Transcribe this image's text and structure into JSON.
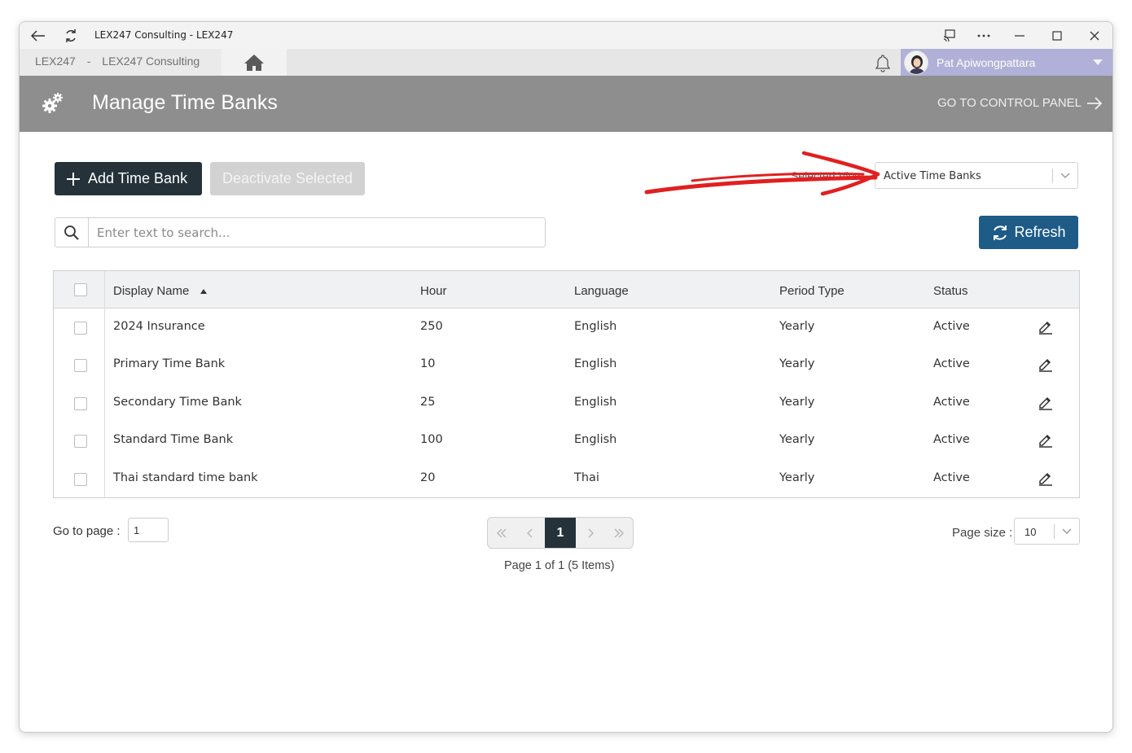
{
  "window": {
    "title": "LEX247 Consulting - LEX247"
  },
  "appbar": {
    "crumb_org": "LEX247",
    "crumb_sep": "-",
    "crumb_company": "LEX247 Consulting",
    "user_name": "Pat Apiwongpattara",
    "user_color": "#b0b0d8"
  },
  "header": {
    "title": "Manage Time Banks",
    "go_to": "GO TO CONTROL PANEL",
    "bg_color": "#8e8e8e"
  },
  "toolbar": {
    "add_label": "Add Time Bank",
    "deactivate_label": "Deactivate Selected",
    "selected_view_label": "Selected View",
    "selected_view_value": "Active Time Banks",
    "refresh_label": "Refresh"
  },
  "search": {
    "placeholder": "Enter text to search..."
  },
  "grid": {
    "columns": [
      "Display Name",
      "Hour",
      "Language",
      "Period Type",
      "Status"
    ],
    "sort_column": "Display Name",
    "sort_direction": "ascending",
    "rows": [
      {
        "name": "2024 Insurance",
        "hour": "250",
        "language": "English",
        "period": "Yearly",
        "status": "Active"
      },
      {
        "name": "Primary Time Bank",
        "hour": "10",
        "language": "English",
        "period": "Yearly",
        "status": "Active"
      },
      {
        "name": "Secondary Time Bank",
        "hour": "25",
        "language": "English",
        "period": "Yearly",
        "status": "Active"
      },
      {
        "name": "Standard Time Bank",
        "hour": "100",
        "language": "English",
        "period": "Yearly",
        "status": "Active"
      },
      {
        "name": "Thai standard time bank",
        "hour": "20",
        "language": "Thai",
        "period": "Yearly",
        "status": "Active"
      }
    ]
  },
  "pagination": {
    "goto_label": "Go to page :",
    "goto_value": "1",
    "current_page": "1",
    "info": "Page 1 of 1 (5 Items)",
    "size_label": "Page size :",
    "size_value": "10"
  },
  "icons": {
    "titlebar": [
      "back-arrow-icon",
      "refresh-icon",
      "cast-icon",
      "more-icon"
    ],
    "row_action": "pencil-icon"
  },
  "colors": {
    "primary_dark": "#25323a",
    "refresh_blue": "#1f5b87",
    "annotation_red": "#e02020"
  }
}
